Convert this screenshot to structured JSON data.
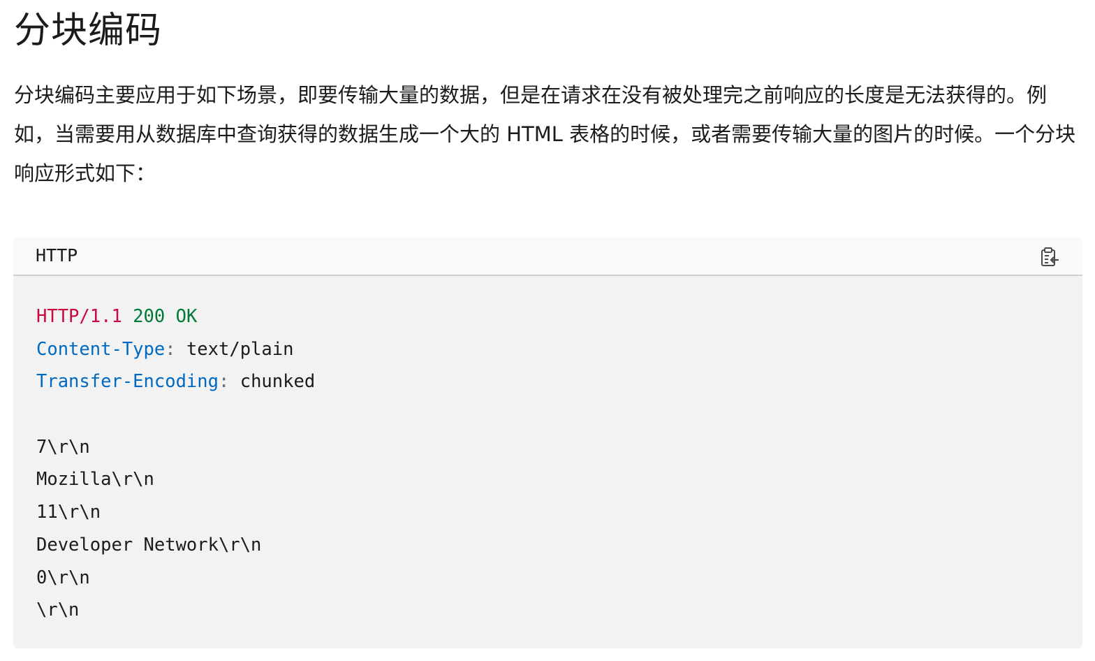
{
  "heading": "分块编码",
  "paragraph": "分块编码主要应用于如下场景，即要传输大量的数据，但是在请求在没有被处理完之前响应的长度是无法获得的。例如，当需要用从数据库中查询获得的数据生成一个大的 HTML 表格的时候，或者需要传输大量的图片的时候。一个分块响应形式如下：",
  "code_block": {
    "language": "HTTP",
    "copy_icon": "clipboard-copy-icon",
    "status_line": {
      "protocol": "HTTP/1.1",
      "status": "200 OK"
    },
    "headers": [
      {
        "name": "Content-Type",
        "separator": ":",
        "value": " text/plain"
      },
      {
        "name": "Transfer-Encoding",
        "separator": ":",
        "value": " chunked"
      }
    ],
    "body_lines": [
      "7\\r\\n",
      "Mozilla\\r\\n",
      "11\\r\\n",
      "Developer Network\\r\\n",
      "0\\r\\n",
      "\\r\\n"
    ]
  },
  "colors": {
    "protocol": "#c8083e",
    "status": "#007936",
    "header_name": "#0069c2",
    "code_background": "#f2f2f2",
    "code_header_background": "#f9f9fb"
  }
}
